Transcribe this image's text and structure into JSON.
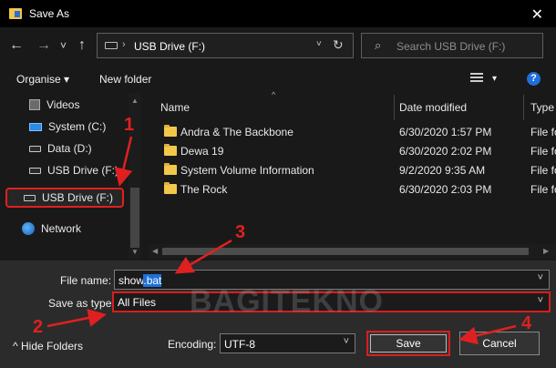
{
  "window": {
    "title": "Save As",
    "close_glyph": "✕"
  },
  "nav": {
    "back_glyph": "←",
    "forward_glyph": "→",
    "recent_glyph": "˅",
    "up_glyph": "↑",
    "address": "USB Drive (F:)",
    "address_sep": "›",
    "address_chevron": "˅",
    "refresh_glyph": "↻",
    "search_placeholder": "Search USB Drive (F:)",
    "search_glyph": "⌕"
  },
  "toolbar": {
    "organise": "Organise",
    "new_folder": "New folder",
    "dropdown_glyph": "▾",
    "help_glyph": "?"
  },
  "sidebar": {
    "items": [
      {
        "label": "Videos",
        "icon": "video-folder-icon"
      },
      {
        "label": "System (C:)",
        "icon": "windows-drive-icon"
      },
      {
        "label": "Data (D:)",
        "icon": "drive-icon"
      },
      {
        "label": "USB Drive (F:)",
        "icon": "usb-drive-icon"
      },
      {
        "label": "USB Drive (F:)",
        "icon": "usb-drive-icon",
        "selected": true
      },
      {
        "label": "Network",
        "icon": "network-icon"
      }
    ],
    "scroll_up": "▲",
    "scroll_down": "▼"
  },
  "files": {
    "columns": [
      "Name",
      "Date modified",
      "Type"
    ],
    "sort_glyph": "^",
    "rows": [
      {
        "name": "Andra & The Backbone",
        "date": "6/30/2020 1:57 PM",
        "type": "File fo"
      },
      {
        "name": "Dewa 19",
        "date": "6/30/2020 2:02 PM",
        "type": "File fo"
      },
      {
        "name": "System Volume Information",
        "date": "9/2/2020 9:35 AM",
        "type": "File fo"
      },
      {
        "name": "The Rock",
        "date": "6/30/2020 2:03 PM",
        "type": "File fo"
      }
    ],
    "scroll_left": "◀",
    "scroll_right": "▶"
  },
  "form": {
    "file_name_label": "File name:",
    "file_name_base": "show",
    "file_name_ext": ".bat",
    "save_type_label": "Save as type:",
    "save_type_value": "All Files",
    "hide_folders": "Hide Folders",
    "hide_glyph": "^",
    "encoding_label": "Encoding:",
    "encoding_value": "UTF-8",
    "save": "Save",
    "cancel": "Cancel",
    "chevron": "˅"
  },
  "watermark": "BAGITEKNO",
  "annotations": {
    "n1": "1",
    "n2": "2",
    "n3": "3",
    "n4": "4",
    "color": "#e02020"
  },
  "colors": {
    "accent": "#1e6fd9",
    "highlight_red": "#d81e1e",
    "folder": "#f2c84b"
  }
}
